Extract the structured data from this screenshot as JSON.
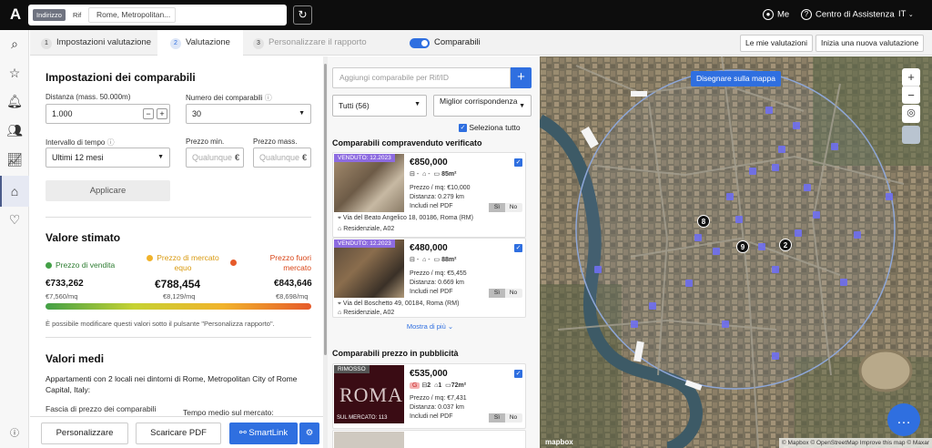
{
  "header": {
    "logo": "A",
    "search_mode_address": "Indirizzo",
    "search_mode_ref": "Rif",
    "search_value": "Rome, Metropolitan...",
    "user_label": "Me",
    "help_label": "Centro di Assistenza",
    "language": "IT"
  },
  "tabs": [
    {
      "num": "1",
      "label": "Impostazioni valutazione"
    },
    {
      "num": "2",
      "label": "Valutazione"
    },
    {
      "num": "3",
      "label": "Personalizzare il rapporto"
    }
  ],
  "comparabili_toggle_label": "Comparabili",
  "top_buttons": {
    "my_valuations": "Le mie valutazioni",
    "new_valuation": "Inizia una nuova valutazione"
  },
  "settings": {
    "title": "Impostazioni dei comparabili",
    "distance_label": "Distanza (mass. 50.000m)",
    "distance_value": "1.000",
    "count_label": "Numero dei comparabili",
    "count_value": "30",
    "time_label": "Intervallo di tempo",
    "time_value": "Ultimi 12 mesi",
    "min_price_label": "Prezzo min.",
    "max_price_label": "Prezzo mass.",
    "price_placeholder": "Qualunque",
    "currency": "€",
    "apply_label": "Applicare"
  },
  "estimate": {
    "title": "Valore stimato",
    "sale_label": "Prezzo di vendita",
    "market_label": "Prezzo di mercato equo",
    "out_label": "Prezzo fuori mercato",
    "sale_value": "€733,262",
    "market_value": "€788,454",
    "out_value": "€843,646",
    "sale_sqm": "€7,560/mq",
    "market_sqm": "€8,129/mq",
    "out_sqm": "€8,698/mq",
    "note": "È possibile modificare questi valori sotto il pulsante \"Personalizza rapporto\".",
    "colors": {
      "sale": "#43a047",
      "market": "#f1b32b",
      "out": "#e65a2a"
    }
  },
  "averages": {
    "title": "Valori medi",
    "description": "Appartamenti con 2 locali nei dintorni di Rome, Metropolitan City of Rome Capital, Italy:",
    "range_label": "Fascia di prezzo dei comparabili",
    "time_label": "Tempo medio sul mercato:"
  },
  "bottom_buttons": {
    "customize": "Personalizzare",
    "download": "Scaricare PDF",
    "smartlink": "SmartLink"
  },
  "comparables": {
    "add_placeholder": "Aggiungi comparabile per Rif/ID",
    "filter_value": "Tutti (56)",
    "sort_value": "Miglior corrispondenza",
    "select_all_label": "Seleziona tutto",
    "sold_section_title": "Comparabili compravenduto verificato",
    "ad_section_title": "Comparabili prezzo in pubblicità",
    "show_more": "Mostra di più",
    "include_pdf_label": "Includi nel PDF",
    "yes": "Sì",
    "no": "No",
    "sold": [
      {
        "badge": "VENDUTO: 12.2023",
        "price": "€850,000",
        "rooms": "-",
        "baths": "-",
        "area": "85m²",
        "price_sqm": "Prezzo / mq: €10,000",
        "distance": "Distanza: 0.279 km",
        "address": "Via del Beato Angelico 18, 00186, Roma (RM)",
        "type": "Residenziale, A02"
      },
      {
        "badge": "VENDUTO: 12.2023",
        "price": "€480,000",
        "rooms": "-",
        "baths": "-",
        "area": "88m²",
        "price_sqm": "Prezzo / mq: €5,455",
        "distance": "Distanza: 0.669 km",
        "address": "Via del Boschetto 49, 00184, Roma (RM)",
        "type": "Residenziale, A02"
      }
    ],
    "ads": [
      {
        "badge": "RIMOSSO",
        "status": "G",
        "price": "€535,000",
        "rooms": "2",
        "baths": "1",
        "area": "72m²",
        "price_sqm": "Prezzo / mq: €7,431",
        "distance": "Distanza: 0.037 km",
        "market_badge": "SUL MERCATO: 113",
        "image_text": "ROMA"
      }
    ]
  },
  "map": {
    "draw_button": "Disegnare sulla mappa",
    "clusters": [
      "8",
      "9",
      "2"
    ],
    "logo": "mapbox",
    "attribution": "© Mapbox © OpenStreetMap Improve this map © Maxar"
  }
}
